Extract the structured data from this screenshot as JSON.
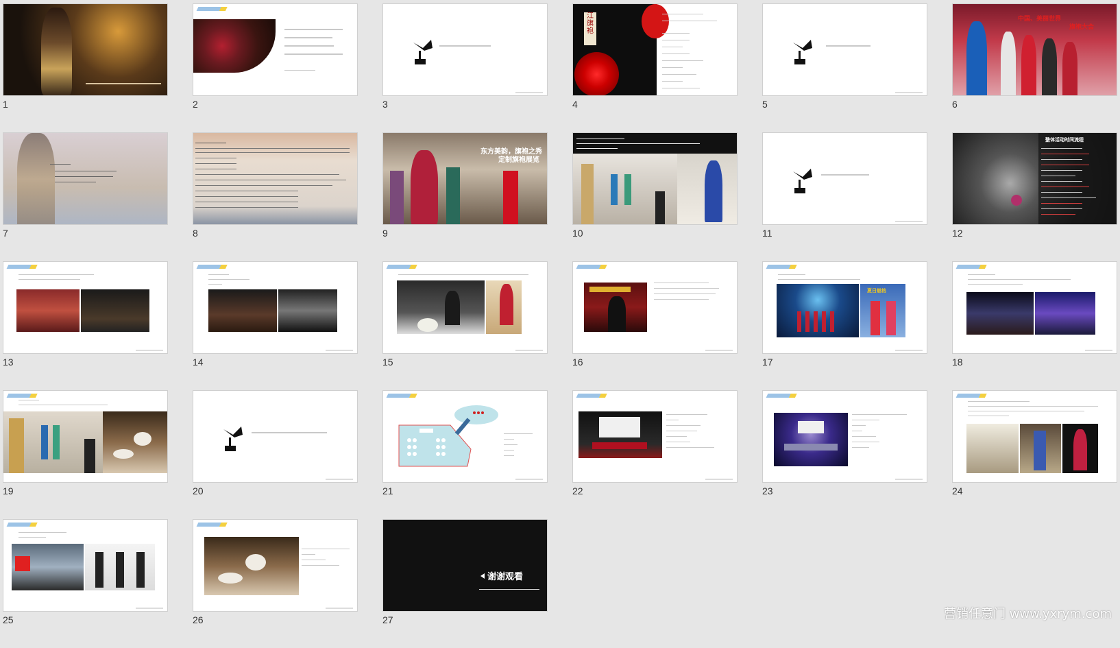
{
  "slides": [
    {
      "n": "1"
    },
    {
      "n": "2"
    },
    {
      "n": "3"
    },
    {
      "n": "4"
    },
    {
      "n": "5"
    },
    {
      "n": "6"
    },
    {
      "n": "7"
    },
    {
      "n": "8"
    },
    {
      "n": "9"
    },
    {
      "n": "10"
    },
    {
      "n": "11"
    },
    {
      "n": "12"
    },
    {
      "n": "13"
    },
    {
      "n": "14"
    },
    {
      "n": "15"
    },
    {
      "n": "16"
    },
    {
      "n": "17"
    },
    {
      "n": "18"
    },
    {
      "n": "19"
    },
    {
      "n": "20"
    },
    {
      "n": "21"
    },
    {
      "n": "22"
    },
    {
      "n": "23"
    },
    {
      "n": "24"
    },
    {
      "n": "25"
    },
    {
      "n": "26"
    },
    {
      "n": "27"
    }
  ],
  "text": {
    "s4_vertical": "江旗袍",
    "s6_title_line1": "中国、美丽世界",
    "s6_title_line2": "旗袍大会",
    "s9_title_line1": "东方美韵，旗袍之秀",
    "s9_title_line2": "定制旗袍展览",
    "s12_title": "整体活动时间流程",
    "s17_label": "夏日魅格",
    "s27_thanks": "谢谢观看",
    "watermark": "营销任意门 www.yxrym.com"
  },
  "colors": {
    "accent_red": "#e02020",
    "blue_tag": "#9cc3e6",
    "yellow_tag": "#f4d03f",
    "map_blue": "#bfe3ea"
  }
}
